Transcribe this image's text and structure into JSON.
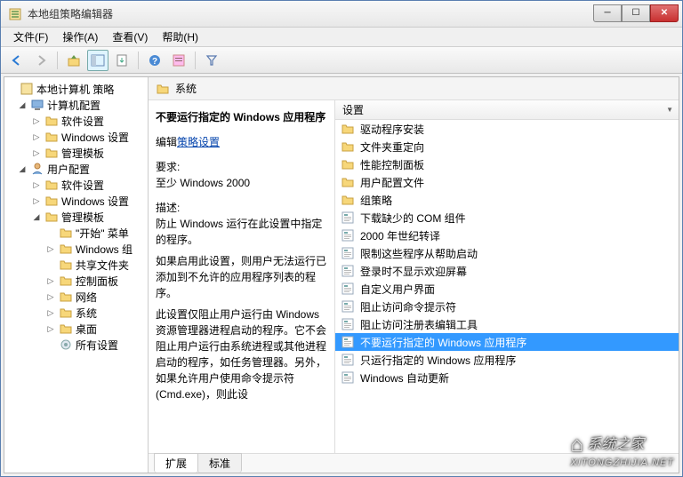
{
  "window": {
    "title": "本地组策略编辑器"
  },
  "menu": {
    "file": "文件(F)",
    "action": "操作(A)",
    "view": "查看(V)",
    "help": "帮助(H)"
  },
  "tree": {
    "root": "本地计算机 策略",
    "computer": "计算机配置",
    "c_software": "软件设置",
    "c_windows": "Windows 设置",
    "c_admin": "管理模板",
    "user": "用户配置",
    "u_software": "软件设置",
    "u_windows": "Windows 设置",
    "u_admin": "管理模板",
    "start_menu": "\"开始\" 菜单",
    "windows_comp": "Windows 组",
    "shared": "共享文件夹",
    "control_panel": "控制面板",
    "network": "网络",
    "system": "系统",
    "desktop": "桌面",
    "all_settings": "所有设置"
  },
  "breadcrumb": {
    "label": "系统"
  },
  "description": {
    "heading": "不要运行指定的 Windows 应用程序",
    "edit_prefix": "编辑",
    "edit_link": "策略设置",
    "req_label": "要求:",
    "req_value": "至少 Windows 2000",
    "desc_label": "描述:",
    "desc_p1": "防止 Windows 运行在此设置中指定的程序。",
    "desc_p2": "如果启用此设置，则用户无法运行已添加到不允许的应用程序列表的程序。",
    "desc_p3": "此设置仅阻止用户运行由 Windows 资源管理器进程启动的程序。它不会阻止用户运行由系统进程或其他进程启动的程序，如任务管理器。另外，如果允许用户使用命令提示符(Cmd.exe)，则此设"
  },
  "list": {
    "header": "设置",
    "items": [
      {
        "type": "folder",
        "label": "驱动程序安装"
      },
      {
        "type": "folder",
        "label": "文件夹重定向"
      },
      {
        "type": "folder",
        "label": "性能控制面板"
      },
      {
        "type": "folder",
        "label": "用户配置文件"
      },
      {
        "type": "folder",
        "label": "组策略"
      },
      {
        "type": "setting",
        "label": "下载缺少的 COM 组件"
      },
      {
        "type": "setting",
        "label": "2000 年世纪转译"
      },
      {
        "type": "setting",
        "label": "限制这些程序从帮助启动"
      },
      {
        "type": "setting",
        "label": "登录时不显示欢迎屏幕"
      },
      {
        "type": "setting",
        "label": "自定义用户界面"
      },
      {
        "type": "setting",
        "label": "阻止访问命令提示符"
      },
      {
        "type": "setting",
        "label": "阻止访问注册表编辑工具"
      },
      {
        "type": "setting",
        "label": "不要运行指定的 Windows 应用程序",
        "selected": true
      },
      {
        "type": "setting",
        "label": "只运行指定的 Windows 应用程序"
      },
      {
        "type": "setting",
        "label": "Windows 自动更新"
      }
    ]
  },
  "tabs": {
    "extended": "扩展",
    "standard": "标准"
  },
  "watermark": {
    "brand": "系统之家",
    "url": "XITONGZHIJIA.NET"
  }
}
